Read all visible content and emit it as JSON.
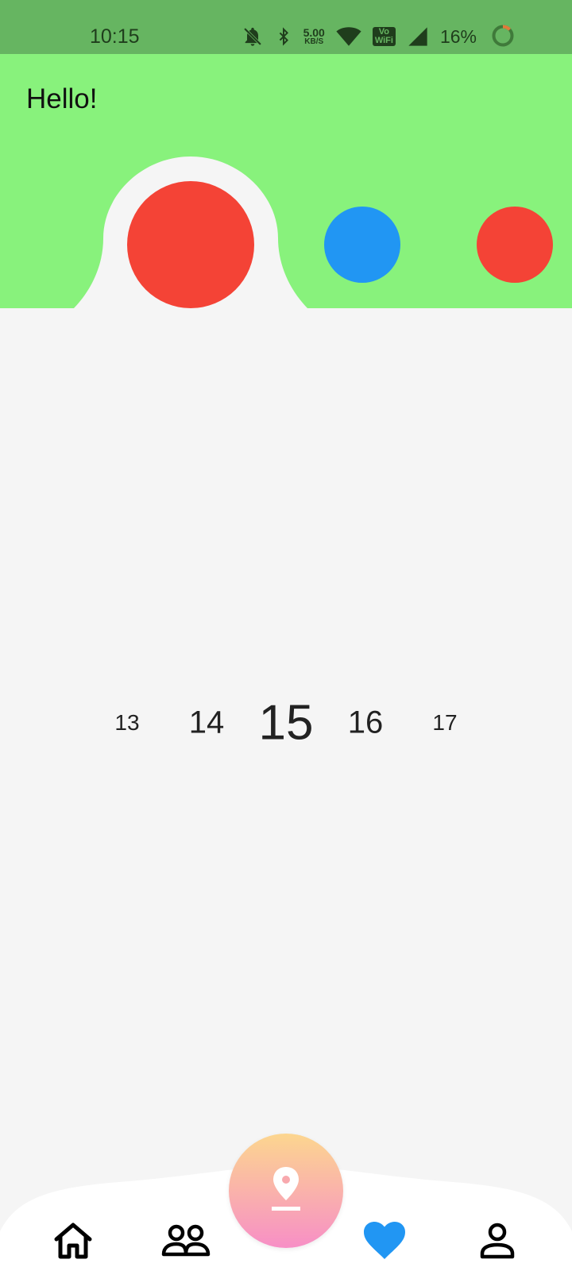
{
  "status_bar": {
    "time": "10:15",
    "net_speed_value": "5.00",
    "net_speed_unit": "KB/S",
    "volte_top": "Vo",
    "volte_bottom": "WiFi",
    "battery": "16%",
    "icons": [
      "bell-off-icon",
      "bluetooth-icon",
      "wifi-icon",
      "signal-icon",
      "battery-ring-icon"
    ]
  },
  "header": {
    "greeting": "Hello!",
    "background_color": "#88f27c",
    "dots": [
      {
        "name": "selected-dot",
        "color": "#f44336"
      },
      {
        "name": "dot",
        "color": "#2196f3"
      },
      {
        "name": "dot",
        "color": "#f44336"
      }
    ]
  },
  "picker": {
    "values": [
      "13",
      "14",
      "15",
      "16",
      "17"
    ],
    "selected": "15"
  },
  "bottom_nav": {
    "items": [
      {
        "name": "home",
        "icon": "home-icon"
      },
      {
        "name": "people",
        "icon": "people-icon"
      },
      {
        "name": "location",
        "icon": "location-pin-icon"
      },
      {
        "name": "favorites",
        "icon": "heart-icon",
        "color": "#2196f3",
        "active": true
      },
      {
        "name": "profile",
        "icon": "person-icon"
      }
    ],
    "fab_gradient": [
      "#fcd68f",
      "#f78fc6"
    ]
  }
}
